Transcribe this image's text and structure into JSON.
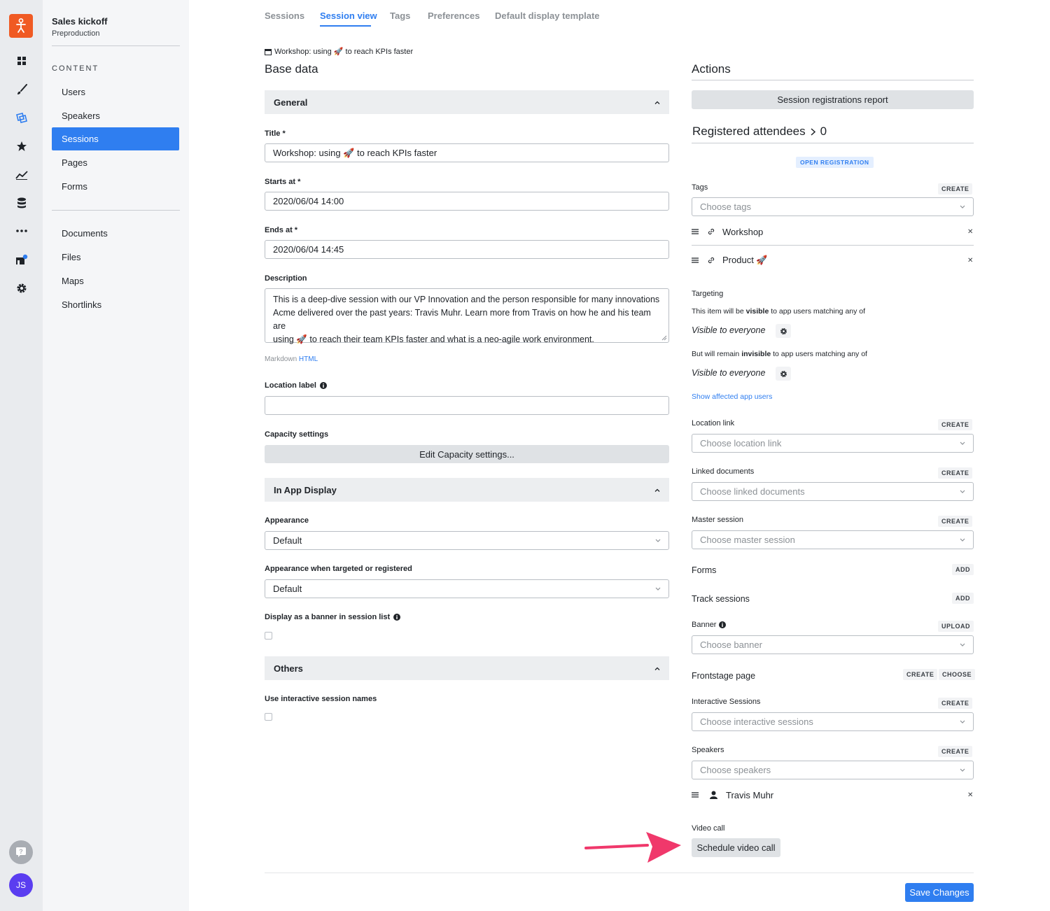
{
  "workspace": {
    "title": "Sales kickoff",
    "subtitle": "Preproduction"
  },
  "sidebar": {
    "section_label": "CONTENT",
    "items": [
      {
        "label": "Users"
      },
      {
        "label": "Speakers"
      },
      {
        "label": "Sessions"
      },
      {
        "label": "Pages"
      },
      {
        "label": "Forms"
      },
      {
        "label": "Documents"
      },
      {
        "label": "Files"
      },
      {
        "label": "Maps"
      },
      {
        "label": "Shortlinks"
      }
    ]
  },
  "user": {
    "initials": "JS"
  },
  "tabs": [
    {
      "label": "Sessions"
    },
    {
      "label": "Session view"
    },
    {
      "label": "Tags"
    },
    {
      "label": "Preferences"
    },
    {
      "label": "Default display template"
    }
  ],
  "breadcrumb": {
    "icon": "calendar-icon",
    "text": "Workshop: using 🚀 to reach KPIs faster"
  },
  "base": {
    "heading": "Base data",
    "general": {
      "label": "General"
    },
    "title_label": "Title *",
    "title_value": "Workshop: using 🚀 to reach KPIs faster",
    "starts_label": "Starts at *",
    "starts_value": "2020/06/04 14:00",
    "ends_label": "Ends at *",
    "ends_value": "2020/06/04 14:45",
    "description_label": "Description",
    "description_lines": [
      "This is a deep-dive session with our VP Innovation and the person responsible for many innovations",
      "Acme delivered over the past years: Travis Muhr. Learn more from Travis on how he and his team are",
      "using 🚀 to reach their team KPIs faster and what is a neo-agile work environment."
    ],
    "format_markdown": "Markdown",
    "format_html": "HTML",
    "location_label": "Location label",
    "capacity_label": "Capacity settings",
    "capacity_button": "Edit Capacity settings...",
    "in_app": {
      "label": "In App Display"
    },
    "appearance_label": "Appearance",
    "appearance_value": "Default",
    "appearance_targeted_label": "Appearance when targeted or registered",
    "appearance_targeted_value": "Default",
    "banner_label": "Display as a banner in session list",
    "others": {
      "label": "Others"
    },
    "interactive_names_label": "Use interactive session names"
  },
  "actions": {
    "heading": "Actions",
    "report_button": "Session registrations report",
    "attendees_label": "Registered attendees",
    "attendees_count": "0",
    "open_registration": "OPEN REGISTRATION",
    "tags": {
      "label": "Tags",
      "create": "CREATE",
      "placeholder": "Choose tags",
      "items": [
        {
          "label": "Workshop"
        },
        {
          "label": "Product 🚀"
        }
      ]
    },
    "targeting": {
      "label": "Targeting",
      "visible_pre": "This item will be ",
      "visible_bold": "visible",
      "visible_post": " to app users matching any of",
      "visible_value": "Visible to everyone",
      "invisible_pre": "But will remain ",
      "invisible_bold": "invisible",
      "invisible_post": " to app users matching any of",
      "invisible_value": "Visible to everyone",
      "show_link": "Show affected app users"
    },
    "location_link": {
      "label": "Location link",
      "create": "CREATE",
      "placeholder": "Choose location link"
    },
    "linked_docs": {
      "label": "Linked documents",
      "create": "CREATE",
      "placeholder": "Choose linked documents"
    },
    "master_session": {
      "label": "Master session",
      "create": "CREATE",
      "placeholder": "Choose master session"
    },
    "forms": {
      "label": "Forms",
      "add": "ADD"
    },
    "track_sessions": {
      "label": "Track sessions",
      "add": "ADD"
    },
    "banner": {
      "label": "Banner",
      "upload": "UPLOAD",
      "placeholder": "Choose banner"
    },
    "frontstage": {
      "label": "Frontstage page",
      "create": "CREATE",
      "choose": "CHOOSE"
    },
    "interactive": {
      "label": "Interactive Sessions",
      "create": "CREATE",
      "placeholder": "Choose interactive sessions"
    },
    "speakers": {
      "label": "Speakers",
      "create": "CREATE",
      "placeholder": "Choose speakers",
      "items": [
        {
          "label": "Travis Muhr"
        }
      ]
    },
    "video_call": {
      "label": "Video call",
      "button": "Schedule video call"
    }
  },
  "footer": {
    "save_button": "Save Changes"
  },
  "colors": {
    "accent": "#2f7ef0",
    "brand": "#f05a23",
    "annotation_arrow": "#f0386b"
  }
}
